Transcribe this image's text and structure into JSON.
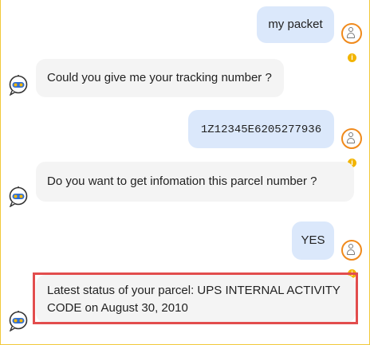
{
  "messages": {
    "m1": "my packet",
    "m2": "Could you give me your tracking number ?",
    "m3": "1Z12345E6205277936",
    "m4": "Do you want to get infomation this parcel number ?",
    "m5": "YES",
    "m6_line1": "Latest status of your parcel: UPS INTERNAL ACTIVITY",
    "m6_line2": "CODE on August 30, 2010"
  },
  "icons": {
    "info_glyph": "i"
  },
  "colors": {
    "user_bubble": "#dbe8fb",
    "bot_bubble": "#f4f4f4",
    "user_avatar_ring": "#f08a1c",
    "info_dot": "#f2b400",
    "highlight": "#e24d4d",
    "frame_border": "#f1c93a"
  }
}
